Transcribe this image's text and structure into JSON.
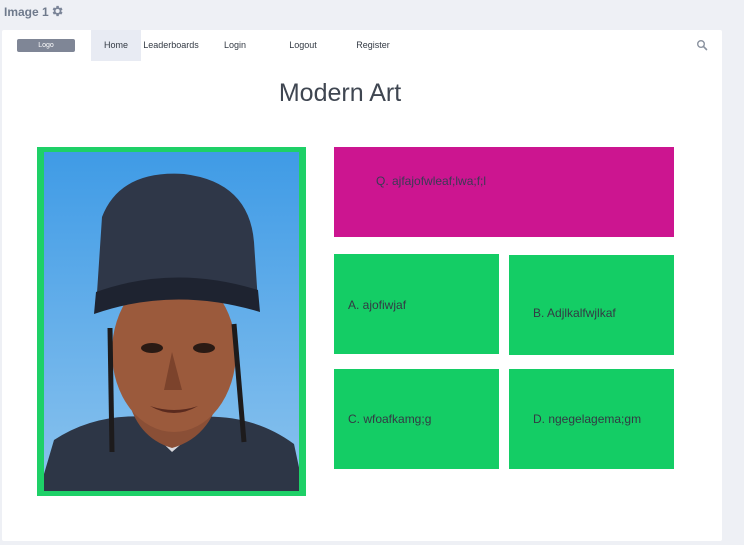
{
  "window": {
    "title": "Image 1"
  },
  "nav": {
    "logo": "Logo",
    "items": [
      "Home",
      "Leaderboards",
      "Login",
      "Logout",
      "Register"
    ]
  },
  "page": {
    "title": "Modern Art"
  },
  "quiz": {
    "question": "Q. ajfajofwleaf;lwa;f;l",
    "answers": [
      "A. ajofiwjaf",
      "B. Adjlkalfwjlkaf",
      "C. wfoafkamg;g",
      "D. ngegelagema;gm"
    ]
  },
  "colors": {
    "question_bg": "#cc1590",
    "answer_bg": "#14cd65",
    "frame": "#1ed067"
  },
  "icons": {
    "settings": "gear-icon",
    "search": "search-icon"
  }
}
